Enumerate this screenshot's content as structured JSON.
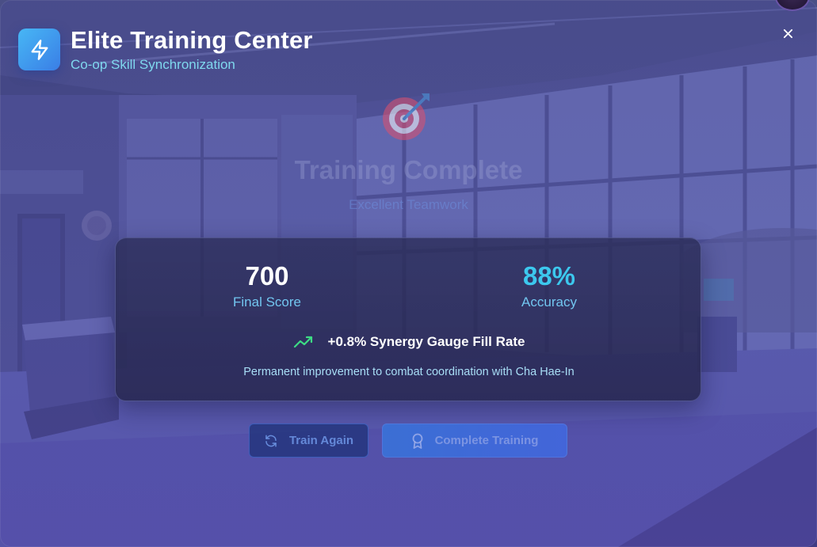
{
  "header": {
    "title": "Elite Training Center",
    "subtitle": "Co-op Skill Synchronization"
  },
  "completion": {
    "title": "Training Complete",
    "subtitle": "Excellent Teamwork"
  },
  "results": {
    "score_value": "700",
    "score_label": "Final Score",
    "accuracy_value": "88%",
    "accuracy_label": "Accuracy",
    "bonus": "+0.8% Synergy Gauge Fill Rate",
    "permanent_note": "Permanent improvement to combat coordination with Cha Hae-In"
  },
  "actions": {
    "train_again": "Train Again",
    "complete_training": "Complete Training"
  },
  "icons": {
    "logo": "lightning-icon",
    "close": "close-icon",
    "target": "target-icon",
    "trend": "trending-up-icon",
    "refresh": "refresh-icon",
    "award": "award-icon"
  },
  "colors": {
    "accent_cyan": "#3cc8ee",
    "accent_blue": "#3a7ee6",
    "trend_green": "#3ddc84"
  }
}
